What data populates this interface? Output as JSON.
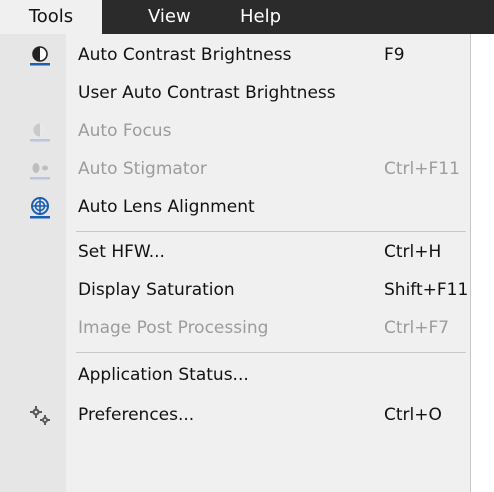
{
  "menubar": {
    "items": [
      {
        "label": "Tools"
      },
      {
        "label": "View"
      },
      {
        "label": "Help"
      }
    ]
  },
  "menu": {
    "items": [
      {
        "label": "Auto Contrast Brightness",
        "shortcut": "F9",
        "icon": "contrast-brightness-icon",
        "disabled": false
      },
      {
        "label": "User Auto Contrast Brightness",
        "shortcut": "",
        "icon": "",
        "disabled": false
      },
      {
        "label": "Auto Focus",
        "shortcut": "",
        "icon": "auto-focus-icon",
        "disabled": true
      },
      {
        "label": "Auto Stigmator",
        "shortcut": "Ctrl+F11",
        "icon": "auto-stigmator-icon",
        "disabled": true
      },
      {
        "label": "Auto Lens Alignment",
        "shortcut": "",
        "icon": "lens-alignment-icon",
        "disabled": false
      },
      {
        "label": "Set HFW...",
        "shortcut": "Ctrl+H",
        "icon": "",
        "disabled": false
      },
      {
        "label": "Display Saturation",
        "shortcut": "Shift+F11",
        "icon": "",
        "disabled": false
      },
      {
        "label": "Image Post Processing",
        "shortcut": "Ctrl+F7",
        "icon": "",
        "disabled": true
      },
      {
        "label": "Application Status...",
        "shortcut": "",
        "icon": "",
        "disabled": false
      },
      {
        "label": "Preferences...",
        "shortcut": "Ctrl+O",
        "icon": "gears-icon",
        "disabled": false
      }
    ]
  },
  "colors": {
    "menubar_bg": "#2b2b2b",
    "menu_bg": "#f0f0f0",
    "icon_blue": "#1a5fb4",
    "disabled_text": "#9c9c9c"
  }
}
